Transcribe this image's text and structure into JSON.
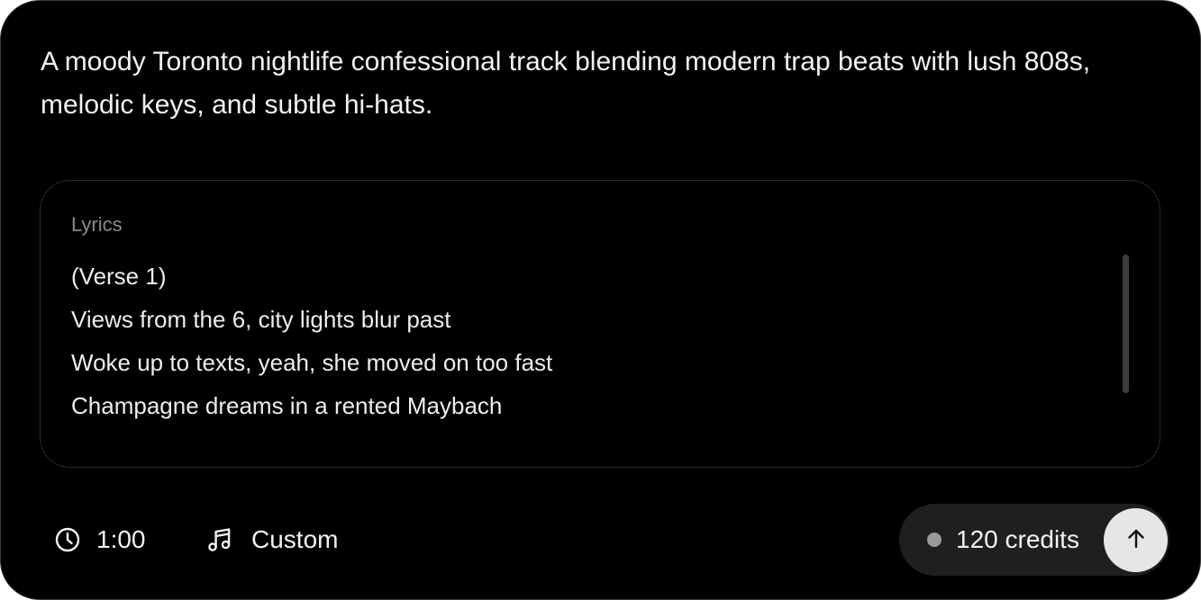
{
  "prompt": {
    "text": "A moody Toronto nightlife confessional track blending modern trap beats with lush 808s, melodic keys, and subtle hi-hats."
  },
  "lyrics": {
    "label": "Lyrics",
    "lines": [
      "(Verse 1)",
      "Views from the 6, city lights blur past",
      "Woke up to texts, yeah, she moved on too fast",
      "Champagne dreams in a rented Maybach"
    ]
  },
  "footer": {
    "duration": {
      "icon": "clock-icon",
      "label": "1:00"
    },
    "style": {
      "icon": "music-note-icon",
      "label": "Custom"
    },
    "credits": {
      "label": "120 credits",
      "dot_color": "#9a9a9a"
    },
    "submit": {
      "icon": "arrow-up-icon"
    }
  },
  "colors": {
    "background": "#000000",
    "text": "#f2f2f2",
    "muted": "#8a8a8a",
    "pill": "#1f1f1f",
    "submit_button": "#e6e6e6"
  }
}
